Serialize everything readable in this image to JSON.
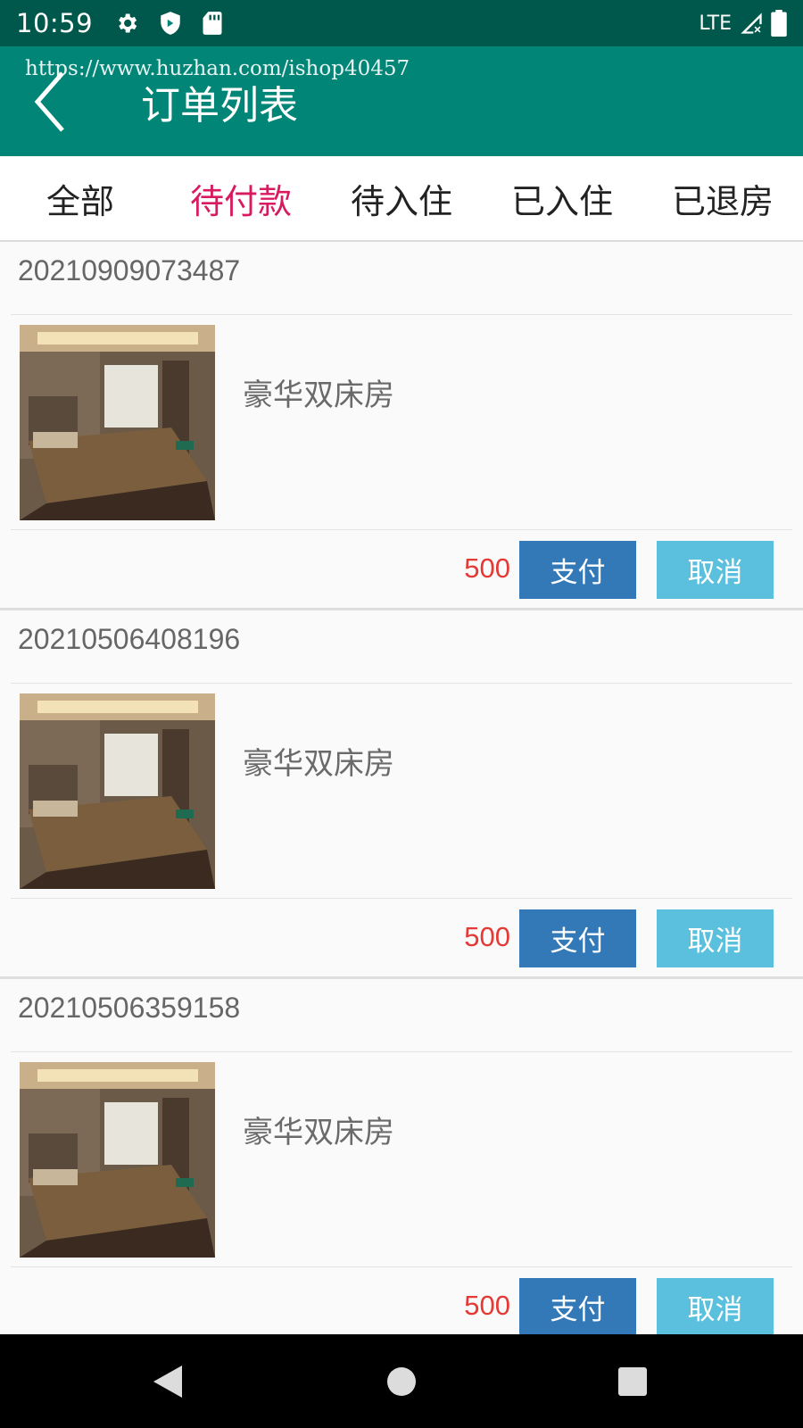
{
  "status_bar": {
    "time": "10:59",
    "network": "LTE",
    "icons": [
      "gear-icon",
      "shield-icon",
      "sd-card-icon",
      "signal-icon",
      "battery-icon"
    ]
  },
  "app_bar": {
    "title": "订单列表",
    "watermark": "https://www.huzhan.com/ishop40457",
    "background": "#008577"
  },
  "tabs": [
    {
      "label": "全部",
      "active": false
    },
    {
      "label": "待付款",
      "active": true
    },
    {
      "label": "待入住",
      "active": false
    },
    {
      "label": "已入住",
      "active": false
    },
    {
      "label": "已退房",
      "active": false
    }
  ],
  "colors": {
    "status_bar": "#00574b",
    "active_tab": "#d81b60",
    "price": "#e53935",
    "pay_button": "#3379b7",
    "cancel_button": "#5bc0de"
  },
  "orders": [
    {
      "order_no": "20210909073487",
      "room_name": "豪华双床房",
      "price": "500",
      "pay_label": "支付",
      "cancel_label": "取消"
    },
    {
      "order_no": "20210506408196",
      "room_name": "豪华双床房",
      "price": "500",
      "pay_label": "支付",
      "cancel_label": "取消"
    },
    {
      "order_no": "20210506359158",
      "room_name": "豪华双床房",
      "price": "500",
      "pay_label": "支付",
      "cancel_label": "取消"
    }
  ],
  "nav_bar": {
    "buttons": [
      "back-triangle-icon",
      "home-circle-icon",
      "recents-square-icon"
    ]
  }
}
